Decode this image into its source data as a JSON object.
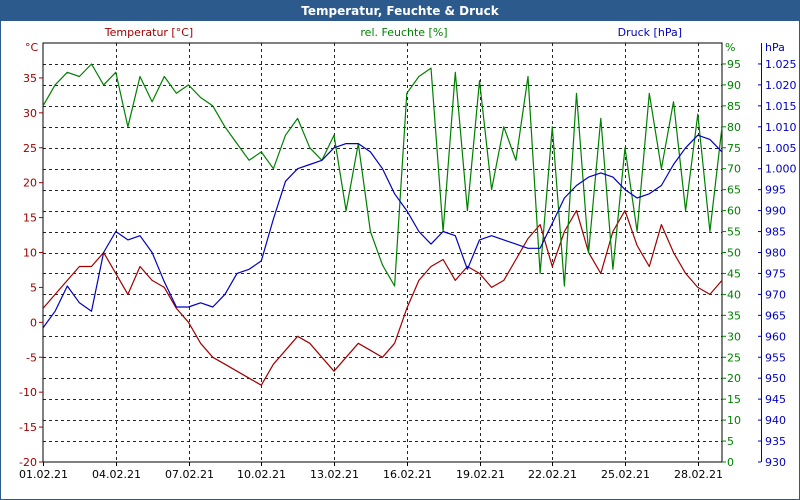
{
  "window": {
    "title": "Temperatur, Feuchte & Druck"
  },
  "chart_data": {
    "type": "line",
    "title": "Temperatur, Feuchte & Druck",
    "x": {
      "start": "01.02.21",
      "end": "01.03.21",
      "tick_labels": [
        "01.02.21",
        "04.02.21",
        "07.02.21",
        "10.02.21",
        "13.02.21",
        "16.02.21",
        "19.02.21",
        "22.02.21",
        "25.02.21",
        "28.02.21"
      ]
    },
    "axes": {
      "temperature": {
        "label": "Temperatur [°C]",
        "unit": "°C",
        "ylim": [
          -20,
          40
        ],
        "ticks": [
          "35",
          "30",
          "25",
          "20",
          "15",
          "10",
          "5",
          "0",
          "-5",
          "-10",
          "-15",
          "-20"
        ],
        "tick_values": [
          35,
          30,
          25,
          20,
          15,
          10,
          5,
          0,
          -5,
          -10,
          -15,
          -20
        ],
        "color": "#a00000"
      },
      "humidity": {
        "label": "rel. Feuchte [%]",
        "unit": "%",
        "ylim": [
          0,
          100
        ],
        "ticks": [
          "95",
          "90",
          "85",
          "80",
          "75",
          "70",
          "65",
          "60",
          "55",
          "50",
          "45",
          "40",
          "35",
          "30",
          "25",
          "20",
          "15",
          "10",
          "5",
          "0"
        ],
        "tick_values": [
          95,
          90,
          85,
          80,
          75,
          70,
          65,
          60,
          55,
          50,
          45,
          40,
          35,
          30,
          25,
          20,
          15,
          10,
          5,
          0
        ],
        "color": "#008000"
      },
      "pressure": {
        "label": "Druck [hPa]",
        "unit": "hPa",
        "ylim": [
          930,
          1030
        ],
        "ticks": [
          "1.025",
          "1.020",
          "1.015",
          "1.010",
          "1.005",
          "1.000",
          "995",
          "990",
          "985",
          "980",
          "975",
          "970",
          "965",
          "960",
          "955",
          "950",
          "945",
          "940",
          "935",
          "930"
        ],
        "tick_values": [
          1025,
          1020,
          1015,
          1010,
          1005,
          1000,
          995,
          990,
          985,
          980,
          975,
          970,
          965,
          960,
          955,
          950,
          945,
          940,
          935,
          930
        ],
        "color": "#0000c0"
      }
    },
    "series": [
      {
        "name": "Temperatur [°C]",
        "axis": "temperature",
        "color": "#a00000",
        "x": [
          "01.02.21",
          "01.02.21 12h",
          "02.02.21",
          "02.02.21 12h",
          "03.02.21",
          "03.02.21 12h",
          "04.02.21",
          "04.02.21 12h",
          "05.02.21",
          "05.02.21 12h",
          "06.02.21",
          "06.02.21 12h",
          "07.02.21",
          "07.02.21 12h",
          "08.02.21",
          "08.02.21 12h",
          "09.02.21",
          "09.02.21 12h",
          "10.02.21",
          "10.02.21 12h",
          "11.02.21",
          "11.02.21 12h",
          "12.02.21",
          "12.02.21 12h",
          "13.02.21",
          "13.02.21 12h",
          "14.02.21",
          "14.02.21 12h",
          "15.02.21",
          "15.02.21 12h",
          "16.02.21",
          "16.02.21 12h",
          "17.02.21",
          "17.02.21 12h",
          "18.02.21",
          "18.02.21 12h",
          "19.02.21",
          "19.02.21 12h",
          "20.02.21",
          "20.02.21 12h",
          "21.02.21",
          "21.02.21 12h",
          "22.02.21",
          "22.02.21 12h",
          "23.02.21",
          "23.02.21 12h",
          "24.02.21",
          "24.02.21 12h",
          "25.02.21",
          "25.02.21 12h",
          "26.02.21",
          "26.02.21 12h",
          "27.02.21",
          "27.02.21 12h",
          "28.02.21",
          "28.02.21 12h",
          "01.03.21"
        ],
        "values": [
          2,
          4,
          6,
          8,
          8,
          10,
          7,
          4,
          8,
          6,
          5,
          2,
          0,
          -3,
          -5,
          -6,
          -7,
          -8,
          -9,
          -6,
          -4,
          -2,
          -3,
          -5,
          -7,
          -5,
          -3,
          -4,
          -5,
          -3,
          2,
          6,
          8,
          9,
          6,
          8,
          7,
          5,
          6,
          9,
          12,
          14,
          8,
          13,
          16,
          10,
          7,
          13,
          16,
          11,
          8,
          14,
          10,
          7,
          5,
          4,
          6
        ]
      },
      {
        "name": "rel. Feuchte [%]",
        "axis": "humidity",
        "color": "#008000",
        "x": [
          "01.02.21",
          "01.02.21 12h",
          "02.02.21",
          "02.02.21 12h",
          "03.02.21",
          "03.02.21 12h",
          "04.02.21",
          "04.02.21 12h",
          "05.02.21",
          "05.02.21 12h",
          "06.02.21",
          "06.02.21 12h",
          "07.02.21",
          "07.02.21 12h",
          "08.02.21",
          "08.02.21 12h",
          "09.02.21",
          "09.02.21 12h",
          "10.02.21",
          "10.02.21 12h",
          "11.02.21",
          "11.02.21 12h",
          "12.02.21",
          "12.02.21 12h",
          "13.02.21",
          "13.02.21 12h",
          "14.02.21",
          "14.02.21 12h",
          "15.02.21",
          "15.02.21 12h",
          "16.02.21",
          "16.02.21 12h",
          "17.02.21",
          "17.02.21 12h",
          "18.02.21",
          "18.02.21 12h",
          "19.02.21",
          "19.02.21 12h",
          "20.02.21",
          "20.02.21 12h",
          "21.02.21",
          "21.02.21 12h",
          "22.02.21",
          "22.02.21 12h",
          "23.02.21",
          "23.02.21 12h",
          "24.02.21",
          "24.02.21 12h",
          "25.02.21",
          "25.02.21 12h",
          "26.02.21",
          "26.02.21 12h",
          "27.02.21",
          "27.02.21 12h",
          "28.02.21",
          "28.02.21 12h",
          "01.03.21"
        ],
        "values": [
          85,
          90,
          93,
          92,
          95,
          90,
          93,
          80,
          92,
          86,
          92,
          88,
          90,
          87,
          85,
          80,
          76,
          72,
          74,
          70,
          78,
          82,
          75,
          72,
          78,
          60,
          76,
          55,
          47,
          42,
          88,
          92,
          94,
          55,
          93,
          60,
          91,
          65,
          80,
          72,
          92,
          45,
          80,
          42,
          88,
          50,
          82,
          46,
          75,
          55,
          88,
          70,
          86,
          60,
          83,
          55,
          80
        ]
      },
      {
        "name": "Druck [hPa]",
        "axis": "pressure",
        "color": "#0000c0",
        "x": [
          "01.02.21",
          "01.02.21 12h",
          "02.02.21",
          "02.02.21 12h",
          "03.02.21",
          "03.02.21 12h",
          "04.02.21",
          "04.02.21 12h",
          "05.02.21",
          "05.02.21 12h",
          "06.02.21",
          "06.02.21 12h",
          "07.02.21",
          "07.02.21 12h",
          "08.02.21",
          "08.02.21 12h",
          "09.02.21",
          "09.02.21 12h",
          "10.02.21",
          "10.02.21 12h",
          "11.02.21",
          "11.02.21 12h",
          "12.02.21",
          "12.02.21 12h",
          "13.02.21",
          "13.02.21 12h",
          "14.02.21",
          "14.02.21 12h",
          "15.02.21",
          "15.02.21 12h",
          "16.02.21",
          "16.02.21 12h",
          "17.02.21",
          "17.02.21 12h",
          "18.02.21",
          "18.02.21 12h",
          "19.02.21",
          "19.02.21 12h",
          "20.02.21",
          "20.02.21 12h",
          "21.02.21",
          "21.02.21 12h",
          "22.02.21",
          "22.02.21 12h",
          "23.02.21",
          "23.02.21 12h",
          "24.02.21",
          "24.02.21 12h",
          "25.02.21",
          "25.02.21 12h",
          "26.02.21",
          "26.02.21 12h",
          "27.02.21",
          "27.02.21 12h",
          "28.02.21",
          "28.02.21 12h",
          "01.03.21"
        ],
        "values": [
          962,
          966,
          972,
          968,
          966,
          980,
          985,
          983,
          984,
          980,
          973,
          967,
          967,
          968,
          967,
          970,
          975,
          976,
          978,
          988,
          997,
          1000,
          1001,
          1002,
          1005,
          1006,
          1006,
          1004,
          1000,
          994,
          990,
          985,
          982,
          985,
          984,
          976,
          983,
          984,
          983,
          982,
          981,
          981,
          987,
          993,
          996,
          998,
          999,
          998,
          995,
          993,
          994,
          996,
          1001,
          1005,
          1008,
          1007,
          1004
        ]
      }
    ],
    "grid": true,
    "grid_style": "dashed",
    "legend": "top (axis headers)"
  }
}
